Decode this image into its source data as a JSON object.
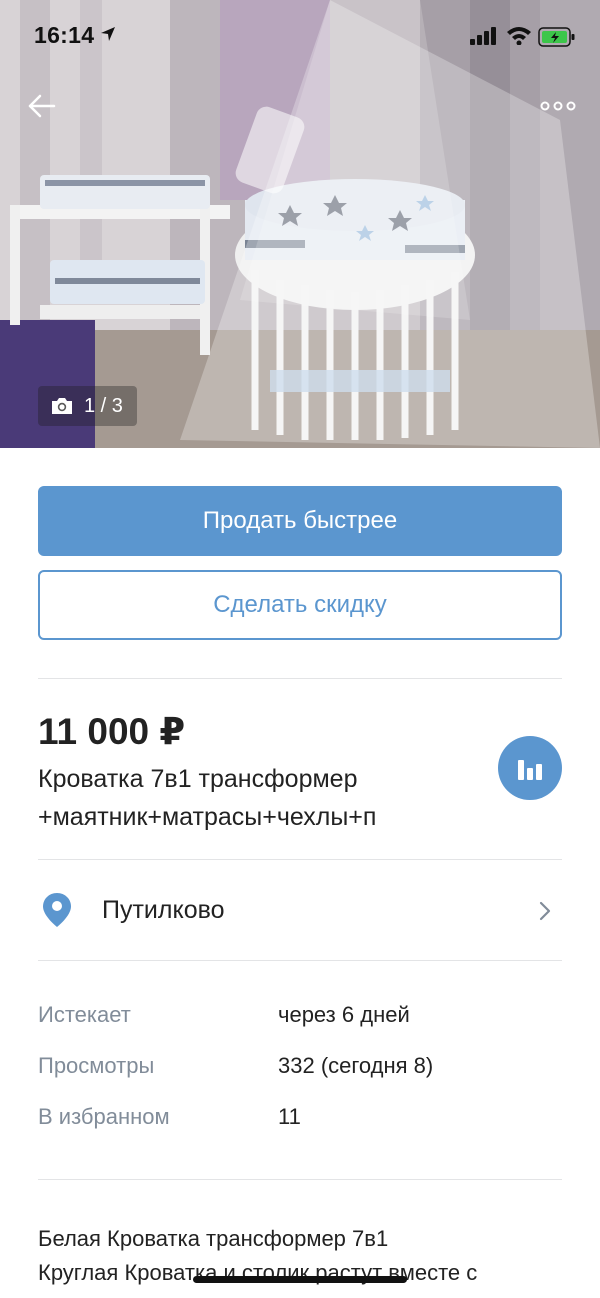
{
  "status_bar": {
    "time": "16:14"
  },
  "photo": {
    "counter": "1 / 3"
  },
  "actions": {
    "sell_faster_label": "Продать быстрее",
    "discount_label": "Сделать скидку"
  },
  "listing": {
    "price": "11 000 ₽",
    "title": "Кроватка 7в1 трансформер +маятник+матрасы+чехлы+п"
  },
  "location": {
    "name": "Путилково"
  },
  "info": [
    {
      "label": "Истекает",
      "value": "через 6 дней"
    },
    {
      "label": "Просмотры",
      "value": "332 (сегодня 8)"
    },
    {
      "label": "В избранном",
      "value": "11"
    }
  ],
  "description": {
    "line1": "Белая Кроватка трансформер 7в1",
    "line2": "Круглая Кроватка и столик растут вместе с"
  },
  "colors": {
    "accent": "#5b96cf",
    "secondary_text": "#818c99",
    "divider": "#e3e4e6"
  },
  "icons": [
    "location-arrow-icon",
    "signal-icon",
    "wifi-icon",
    "battery-icon",
    "back-arrow-icon",
    "more-icon",
    "camera-icon",
    "stats-icon",
    "map-pin-icon",
    "chevron-right-icon"
  ]
}
